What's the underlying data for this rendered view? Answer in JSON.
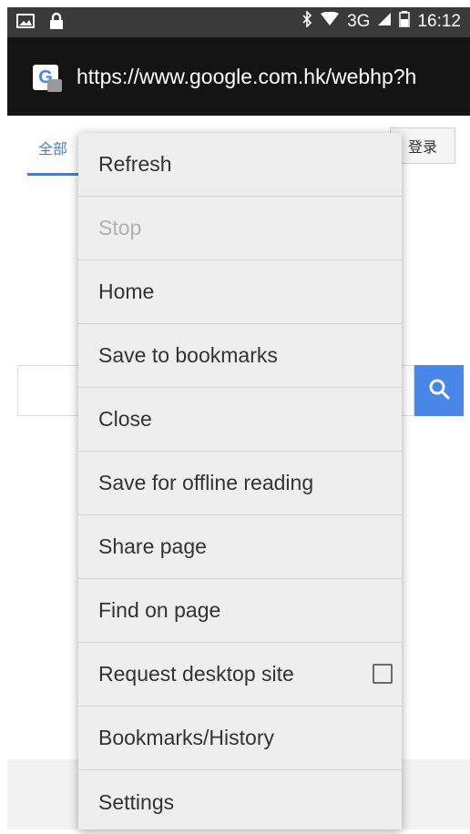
{
  "status_bar": {
    "network": "3G",
    "time": "16:12"
  },
  "browser": {
    "url": "https://www.google.com.hk/webhp?h"
  },
  "page": {
    "tab_all": "全部",
    "login_label": "登录"
  },
  "menu": {
    "items": [
      {
        "label": "Refresh",
        "enabled": true
      },
      {
        "label": "Stop",
        "enabled": false
      },
      {
        "label": "Home",
        "enabled": true
      },
      {
        "label": "Save to bookmarks",
        "enabled": true
      },
      {
        "label": "Close",
        "enabled": true
      },
      {
        "label": "Save for offline reading",
        "enabled": true
      },
      {
        "label": "Share page",
        "enabled": true
      },
      {
        "label": "Find on page",
        "enabled": true
      },
      {
        "label": "Request desktop site",
        "enabled": true,
        "checked": false
      },
      {
        "label": "Bookmarks/History",
        "enabled": true
      },
      {
        "label": "Settings",
        "enabled": true
      }
    ]
  }
}
